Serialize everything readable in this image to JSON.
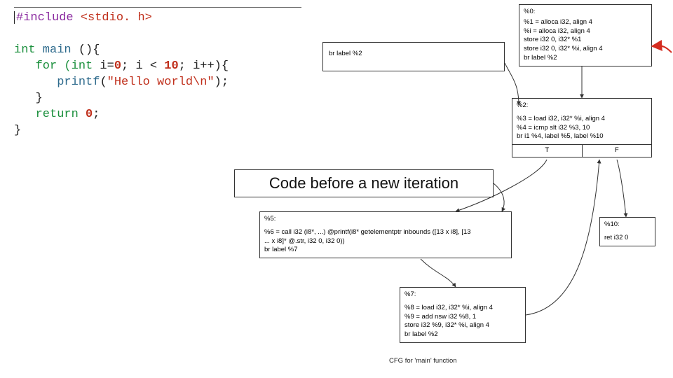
{
  "source": {
    "line1_include": "#include",
    "line1_header": " <stdio. h>",
    "line2_int": "int",
    "line2_main_fn": " main",
    "line2_main_rest": " (){",
    "line3_for": "for",
    "line3_int": " (int",
    "line3_init": " i=0; i < 10; i++){",
    "line3_zero": "0",
    "line3_ten": "10",
    "line4_printf": "printf",
    "line4_str": "(\"Hello world\\n\")",
    "line4_arg": "\"Hello world\\n\"",
    "line4_end": ";",
    "line5_brace": "}",
    "line6_return": "return",
    "line6_zero": " 0",
    "line6_semi": ";",
    "line7_brace": "}"
  },
  "cfg": {
    "mini_label": "br label %2",
    "block0": {
      "title": "%0:",
      "l1": "%1 = alloca i32, align 4",
      "l2": "%i = alloca i32, align 4",
      "l3": "store i32 0, i32* %1",
      "l4": "store i32 0, i32* %i, align 4",
      "l5": "br label %2"
    },
    "block2": {
      "title": "%2:",
      "l1": "%3 = load i32, i32* %i, align 4",
      "l2": "%4 = icmp slt i32 %3, 10",
      "l3": "br i1 %4, label %5, label %10",
      "T": "T",
      "F": "F"
    },
    "block5": {
      "title": "%5:",
      "l1": "%6 = call i32 (i8*, ...) @printf(i8* getelementptr inbounds ([13 x i8], [13",
      "l2": "... x i8]* @.str, i32 0, i32 0))",
      "l3": "br label %7"
    },
    "block7": {
      "title": "%7:",
      "l1": "%8 = load i32, i32* %i, align 4",
      "l2": "%9 = add nsw i32 %8, 1",
      "l3": "store i32 %9, i32* %i, align 4",
      "l4": "br label %2"
    },
    "block10": {
      "title": "%10:",
      "l1": "ret i32 0"
    },
    "caption": "CFG for 'main' function"
  },
  "annotation": "Code before a new iteration"
}
